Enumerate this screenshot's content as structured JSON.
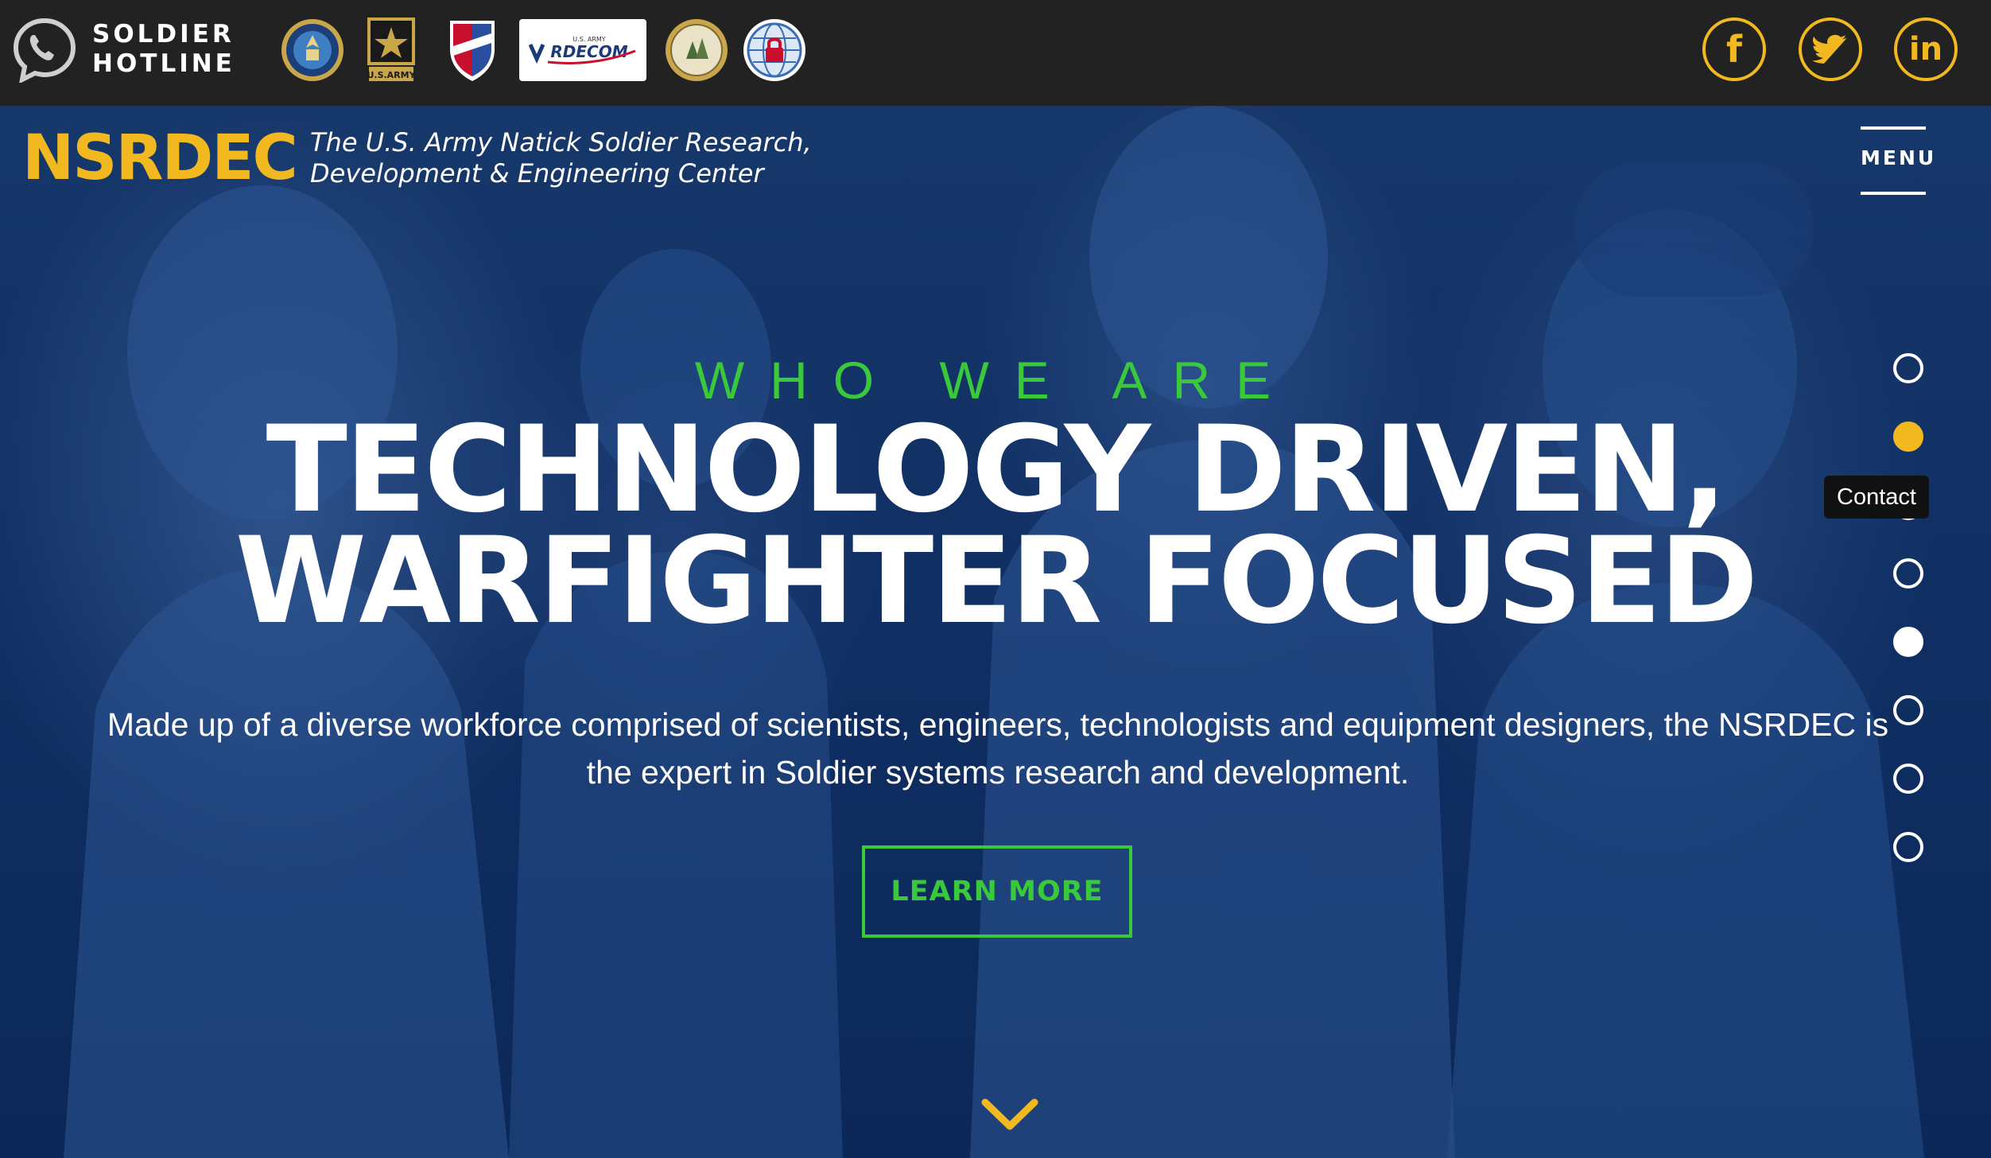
{
  "hotline": {
    "line1": "SOLDIER",
    "line2": "HOTLINE",
    "icon": "phone-bubble-icon"
  },
  "partner_logos": [
    {
      "name": "dod-seal",
      "label": ""
    },
    {
      "name": "us-army-star",
      "label": "U.S.ARMY"
    },
    {
      "name": "amc-shield",
      "label": ""
    },
    {
      "name": "rdecom",
      "label": "RDECOM",
      "small": "U.S. ARMY"
    },
    {
      "name": "natick-seal",
      "label": ""
    },
    {
      "name": "security-globe",
      "label": ""
    }
  ],
  "social": {
    "facebook": "f",
    "twitter": "twitter-bird-icon",
    "linkedin": "in"
  },
  "header": {
    "brand": "NSRDEC",
    "tagline_line1": "The U.S. Army Natick Soldier Research,",
    "tagline_line2": "Development & Engineering Center",
    "menu_label": "MENU"
  },
  "hero": {
    "eyebrow": "WHO WE ARE",
    "headline_line1": "TECHNOLOGY DRIVEN,",
    "headline_line2": "WARFIGHTER FOCUSED",
    "lead": "Made up of a diverse workforce comprised of scientists, engineers, technologists and equipment designers, the NSRDEC is the expert in Soldier systems research and development.",
    "cta": "LEARN MORE"
  },
  "dot_nav": {
    "count": 8,
    "active_index": 1,
    "hover_index": 4,
    "tooltip": "Contact"
  },
  "colors": {
    "accent_yellow": "#f2b81f",
    "accent_green": "#39c93b",
    "topbar": "#222222",
    "hero_blue": "#0b2a5a"
  }
}
